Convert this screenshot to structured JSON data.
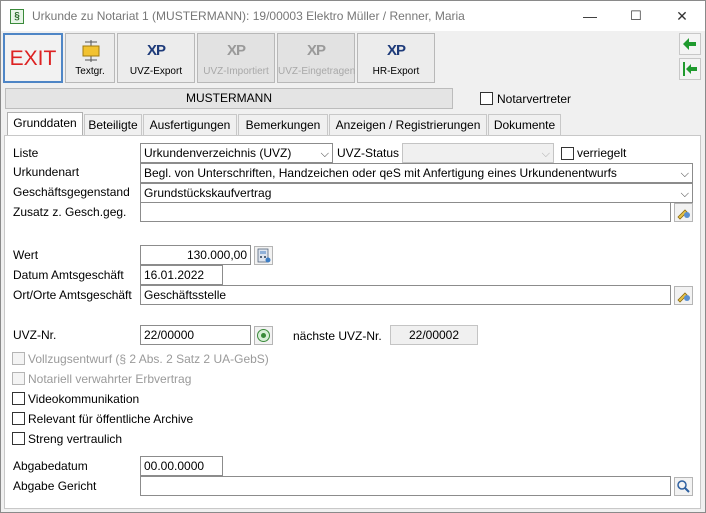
{
  "window": {
    "title": "Urkunde zu Notariat 1 (MUSTERMANN): 19/00003 Elektro Müller / Renner, Maria",
    "app_icon_glyph": "§",
    "minimize_glyph": "—",
    "maximize_glyph": "☐",
    "close_glyph": "✕"
  },
  "toolbar": {
    "exit_label": "EXIT",
    "textgr_label": "Textgr.",
    "uvz_export_label": "UVZ-Export",
    "uvz_importiert_label": "UVZ-Importiert",
    "uvz_eingetragen_label": "UVZ-Eingetragen",
    "hr_export_label": "HR-Export",
    "logo_x": "X",
    "logo_p": "P",
    "accent_color": "#d22222",
    "arrow_color": "#1f9a2e"
  },
  "header": {
    "notary_name": "MUSTERMANN",
    "notarvertreter_label": "Notarvertreter",
    "notarvertreter_checked": false
  },
  "tabs": [
    {
      "label": "Grunddaten",
      "active": true
    },
    {
      "label": "Beteiligte",
      "active": false
    },
    {
      "label": "Ausfertigungen",
      "active": false
    },
    {
      "label": "Bemerkungen",
      "active": false
    },
    {
      "label": "Anzeigen / Registrierungen",
      "active": false
    },
    {
      "label": "Dokumente",
      "active": false
    }
  ],
  "form": {
    "liste_label": "Liste",
    "liste_value": "Urkundenverzeichnis (UVZ)",
    "uvz_status_label": "UVZ-Status",
    "uvz_status_value": "",
    "verriegelt_label": "verriegelt",
    "verriegelt_checked": false,
    "urkundenart_label": "Urkundenart",
    "urkundenart_value": "Begl. von Unterschriften, Handzeichen oder qeS mit Anfertigung eines Urkundenentwurfs",
    "geschaeftsgegenstand_label": "Geschäftsgegenstand",
    "geschaeftsgegenstand_value": "Grundstückskaufvertrag",
    "zusatz_label": "Zusatz z. Gesch.geg.",
    "zusatz_value": "",
    "wert_label": "Wert",
    "wert_value": "130.000,00",
    "datum_label": "Datum Amtsgeschäft",
    "datum_value": "16.01.2022",
    "ort_label": "Ort/Orte Amtsgeschäft",
    "ort_value": "Geschäftsstelle",
    "uvz_nr_label": "UVZ-Nr.",
    "uvz_nr_value": "22/00000",
    "naechste_label": "nächste UVZ-Nr.",
    "naechste_value": "22/00002",
    "checkboxes": [
      {
        "label": "Vollzugsentwurf (§ 2 Abs. 2 Satz 2 UA-GebS)",
        "checked": false,
        "enabled": false
      },
      {
        "label": "Notariell verwahrter Erbvertrag",
        "checked": false,
        "enabled": false
      },
      {
        "label": "Videokommunikation",
        "checked": false,
        "enabled": true
      },
      {
        "label": "Relevant für öffentliche Archive",
        "checked": false,
        "enabled": true
      },
      {
        "label": "Streng vertraulich",
        "checked": false,
        "enabled": true
      }
    ],
    "abgabedatum_label": "Abgabedatum",
    "abgabedatum_value": "00.00.0000",
    "abgabe_gericht_label": "Abgabe Gericht",
    "abgabe_gericht_value": ""
  },
  "icons": {
    "dropdown": "chevron-down-icon",
    "clear_pick": "pencil-pick-icon",
    "calculator": "calculator-icon",
    "uvz_number": "number-badge-icon",
    "search": "search-icon",
    "arrow_in": "arrow-left-green-icon",
    "arrow_in_2": "arrow-left-bar-green-icon"
  }
}
